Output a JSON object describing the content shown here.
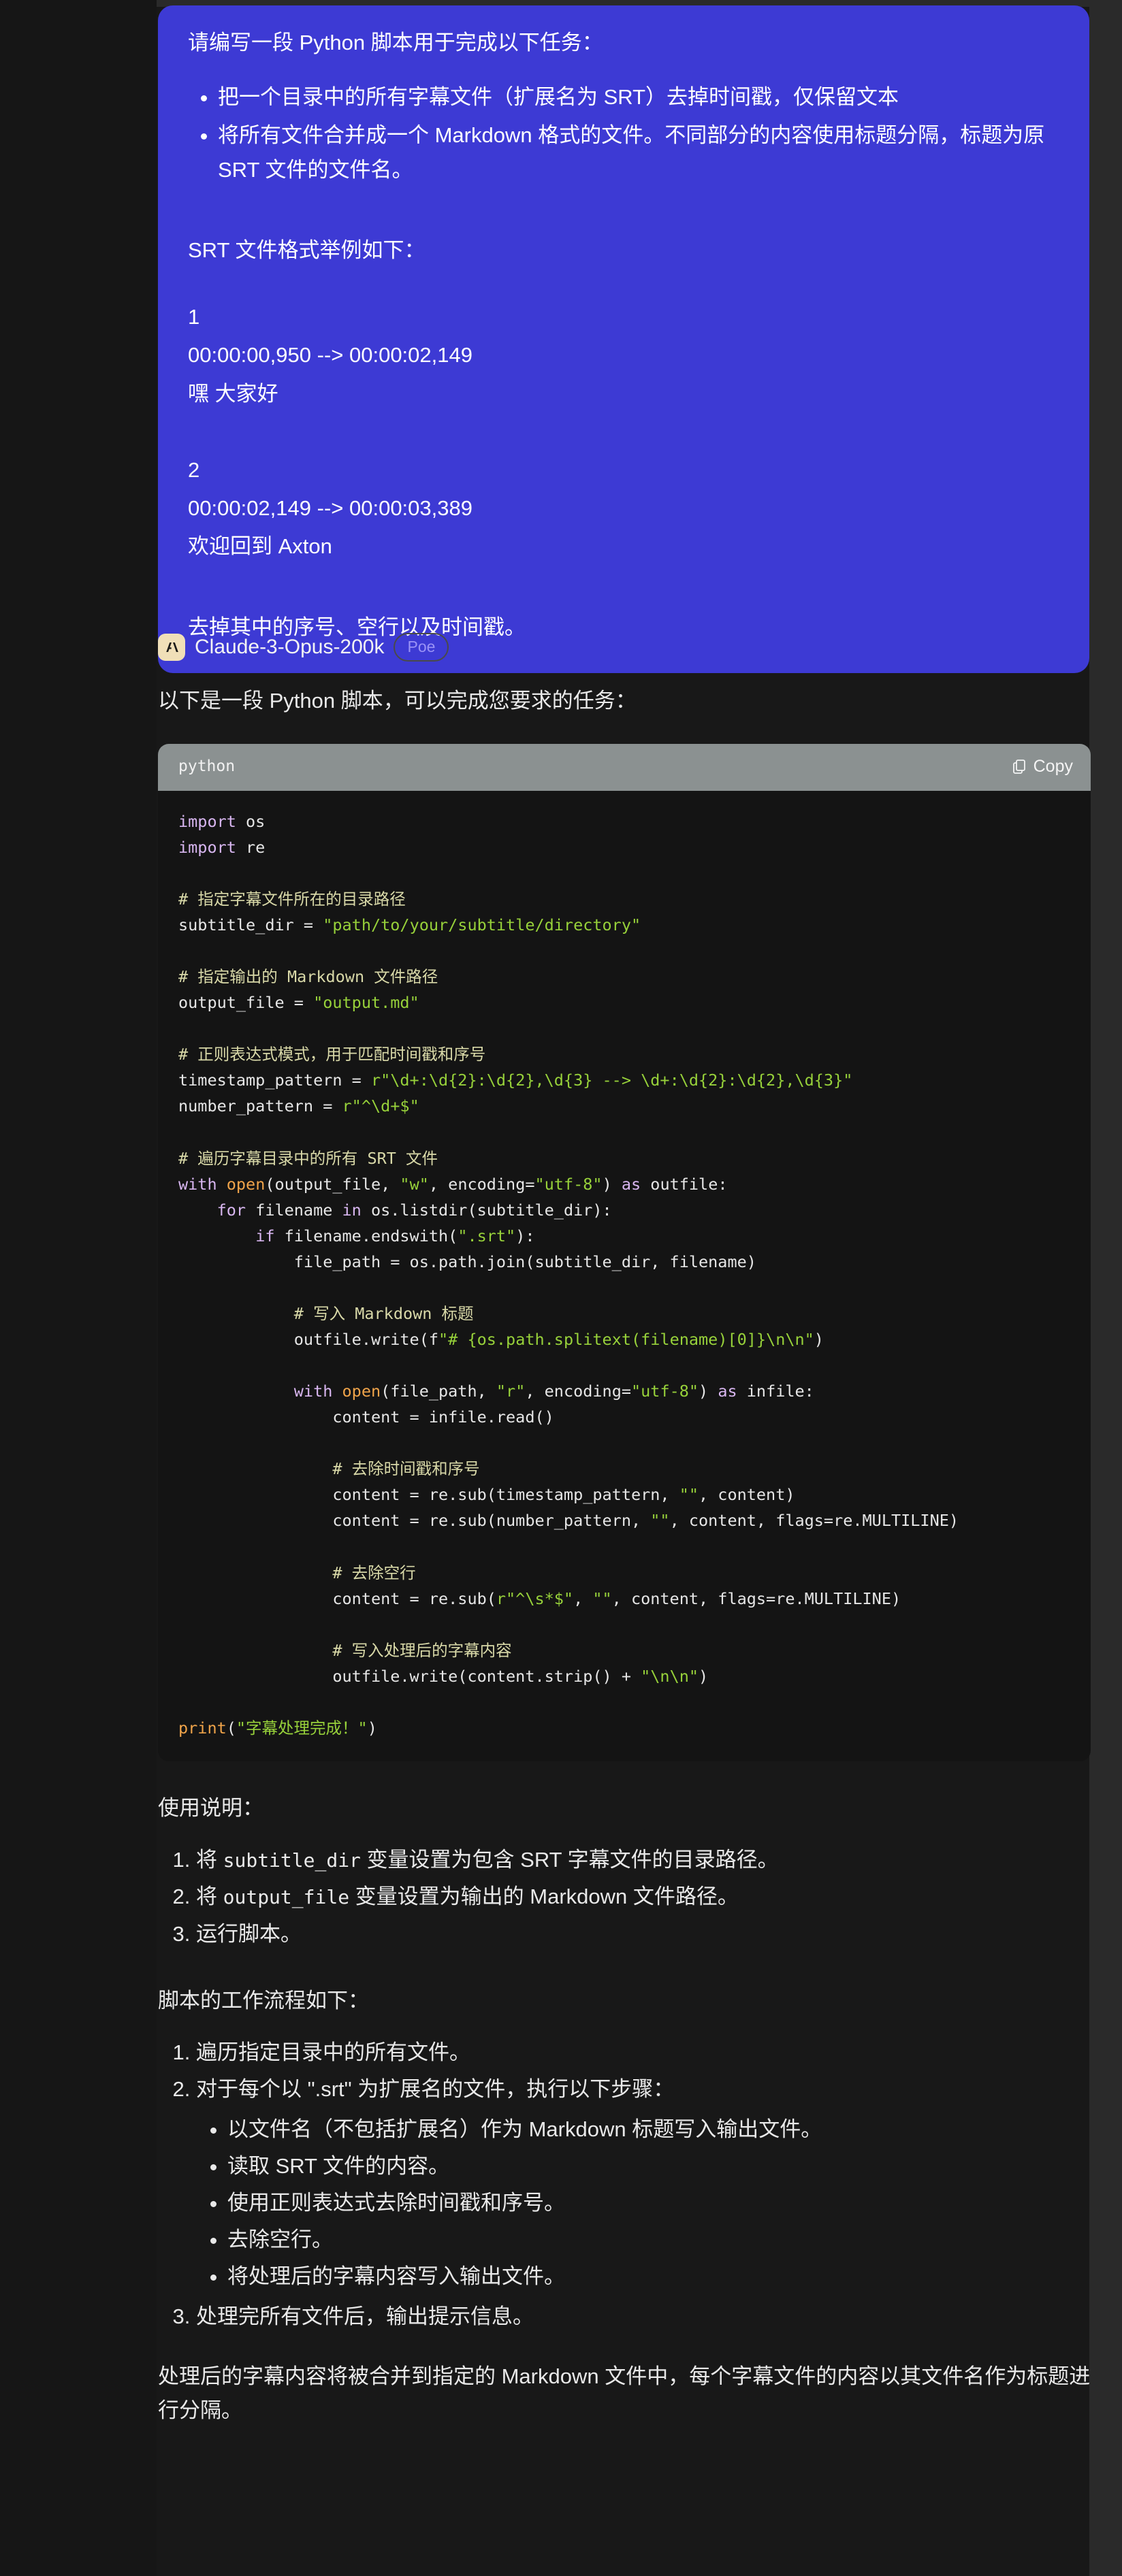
{
  "window": {
    "background": "#181818",
    "user_bubble_color": "#3d3ad4",
    "accent_badge_color": "#9a93f6"
  },
  "user_message": {
    "intro": "请编写一段 Python 脚本用于完成以下任务：",
    "bullets": [
      "把一个目录中的所有字幕文件（扩展名为 SRT）去掉时间戳，仅保留文本",
      "将所有文件合并成一个 Markdown 格式的文件。不同部分的内容使用标题分隔，标题为原 SRT 文件的文件名。"
    ],
    "format_heading": "SRT 文件格式举例如下：",
    "srt_sample": [
      "1",
      "00:00:00,950 --> 00:00:02,149",
      "嘿 大家好",
      "",
      "2",
      "00:00:02,149 --> 00:00:03,389",
      "欢迎回到 Axton"
    ],
    "closing": "去掉其中的序号、空行以及时间戳。"
  },
  "assistant": {
    "avatar_icon": "anthropic-logo-icon",
    "name": "Claude-3-Opus-200k",
    "badge": "Poe",
    "lead": "以下是一段 Python 脚本，可以完成您要求的任务：",
    "code_block": {
      "language_label": "python",
      "copy_label": "Copy",
      "copy_icon": "copy-icon",
      "code": "import os\nimport re\n\n# 指定字幕文件所在的目录路径\nsubtitle_dir = \"path/to/your/subtitle/directory\"\n\n# 指定输出的 Markdown 文件路径\noutput_file = \"output.md\"\n\n# 正则表达式模式，用于匹配时间戳和序号\ntimestamp_pattern = r\"\\d+:\\d{2}:\\d{2},\\d{3} --> \\d+:\\d{2}:\\d{2},\\d{3}\"\nnumber_pattern = r\"^\\d+$\"\n\n# 遍历字幕目录中的所有 SRT 文件\nwith open(output_file, \"w\", encoding=\"utf-8\") as outfile:\n    for filename in os.listdir(subtitle_dir):\n        if filename.endswith(\".srt\"):\n            file_path = os.path.join(subtitle_dir, filename)\n\n            # 写入 Markdown 标题\n            outfile.write(f\"# {os.path.splitext(filename)[0]}\\n\\n\")\n\n            with open(file_path, \"r\", encoding=\"utf-8\") as infile:\n                content = infile.read()\n\n                # 去除时间戳和序号\n                content = re.sub(timestamp_pattern, \"\", content)\n                content = re.sub(number_pattern, \"\", content, flags=re.MULTILINE)\n\n                # 去除空行\n                content = re.sub(r\"^\\s*$\", \"\", content, flags=re.MULTILINE)\n\n                # 写入处理后的字幕内容\n                outfile.write(content.strip() + \"\\n\\n\")\n\nprint(\"字幕处理完成！\")"
    },
    "usage_heading": "使用说明：",
    "usage_steps": [
      "将 subtitle_dir 变量设置为包含 SRT 字幕文件的目录路径。",
      "将 output_file 变量设置为输出的 Markdown 文件路径。",
      "运行脚本。"
    ],
    "workflow_heading": "脚本的工作流程如下：",
    "workflow_steps": [
      "遍历指定目录中的所有文件。",
      "对于每个以 \".srt\" 为扩展名的文件，执行以下步骤：",
      "处理完所有文件后，输出提示信息。"
    ],
    "workflow_substeps": [
      "以文件名（不包括扩展名）作为 Markdown 标题写入输出文件。",
      "读取 SRT 文件的内容。",
      "使用正则表达式去除时间戳和序号。",
      "去除空行。",
      "将处理后的字幕内容写入输出文件。"
    ],
    "conclusion": "处理后的字幕内容将被合并到指定的 Markdown 文件中，每个字幕文件的内容以其文件名作为标题进行分隔。"
  }
}
